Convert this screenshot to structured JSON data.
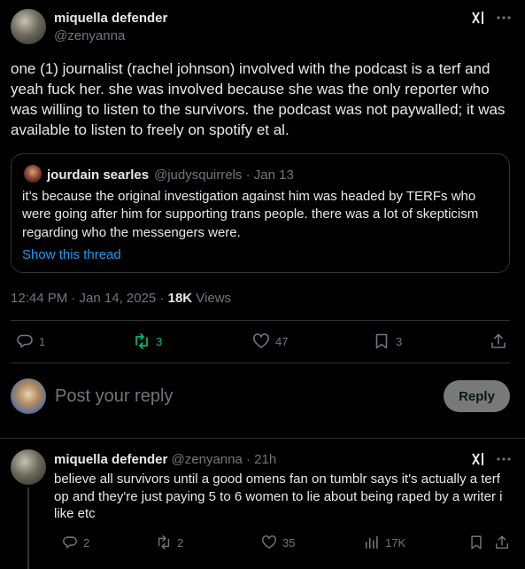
{
  "tweet": {
    "display_name": "miquella defender",
    "handle": "@zenyanna",
    "text": "one (1) journalist (rachel johnson) involved with the podcast is a terf and yeah fuck her. she was involved because she was the only reporter who was willing to listen to the survivors. the podcast was not paywalled; it was available to listen to freely on spotify et al.",
    "timestamp": "12:44 PM · Jan 14, 2025 · ",
    "views_count": "18K",
    "views_label": " Views",
    "replies": "1",
    "reposts": "3",
    "likes": "47",
    "bookmarks": "3"
  },
  "quote": {
    "display_name": "jourdain searles",
    "handle_date": "@judysquirrels · Jan 13",
    "text": "it’s because the original investigation against him was headed by TERFs who were going after him for supporting trans people. there was a lot of skepticism regarding who the messengers were.",
    "show_thread": "Show this thread"
  },
  "composer": {
    "placeholder": "Post your reply",
    "reply_button": "Reply"
  },
  "reply": {
    "display_name": "miquella defender",
    "handle_time": "@zenyanna · 21h",
    "text": "believe all survivors until a good omens fan on tumblr says it's actually a terf op and they're just paying 5 to 6 women to lie about being raped by a writer i like etc",
    "replies": "2",
    "reposts": "2",
    "likes": "35",
    "views": "17K"
  },
  "colors": {
    "background": "#000000",
    "text": "#e7e9ea",
    "muted": "#71767b",
    "link": "#1d9bf0",
    "repost_active": "#00ba7c",
    "divider": "#2f3336"
  },
  "icons": [
    "grok-icon",
    "more-icon",
    "reply-icon",
    "repost-icon",
    "like-icon",
    "bookmark-icon",
    "share-icon",
    "views-icon"
  ]
}
